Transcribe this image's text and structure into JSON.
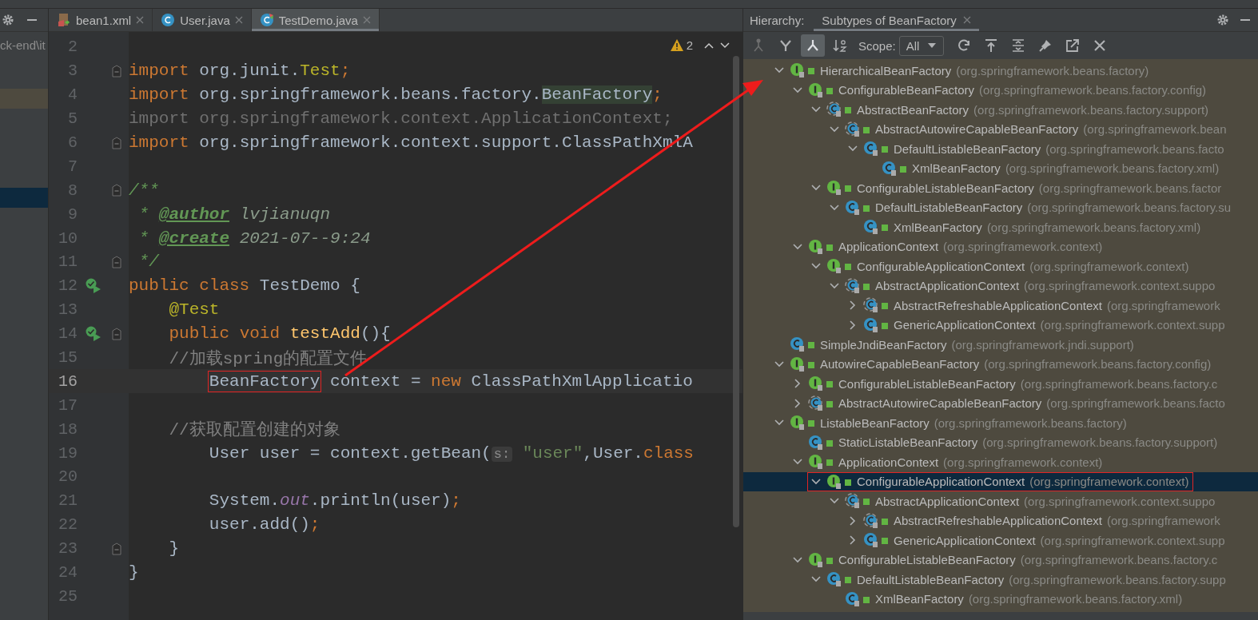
{
  "project_panel": {
    "path_fragment": "ck-end\\it"
  },
  "editor_tabs": [
    {
      "label": "bean1.xml",
      "kind": "xml",
      "selected": false
    },
    {
      "label": "User.java",
      "kind": "class",
      "selected": false
    },
    {
      "label": "TestDemo.java",
      "kind": "test",
      "selected": true
    }
  ],
  "inspection": {
    "warnings": "2"
  },
  "code_lines": [
    {
      "number": "2",
      "current": false
    },
    {
      "number": "3",
      "current": false,
      "fold": true,
      "tokens": [
        {
          "kind": "kw",
          "text": "import"
        },
        {
          "kind": "plain",
          "text": " org.junit."
        },
        {
          "kind": "ann",
          "text": "Test"
        },
        {
          "kind": "kw",
          "text": ";"
        }
      ]
    },
    {
      "number": "4",
      "current": false,
      "tokens": [
        {
          "kind": "kw",
          "text": "import"
        },
        {
          "kind": "plain",
          "text": " org.springframework.beans.factory."
        },
        {
          "kind": "usage",
          "text": "BeanFactory"
        },
        {
          "kind": "kw",
          "text": ";"
        }
      ]
    },
    {
      "number": "5",
      "current": false,
      "tokens": [
        {
          "kind": "unused",
          "text": "import org.springframework.context.ApplicationContext;"
        }
      ]
    },
    {
      "number": "6",
      "current": false,
      "fold": true,
      "tokens": [
        {
          "kind": "kw",
          "text": "import"
        },
        {
          "kind": "plain",
          "text": " org.springframework.context.support.ClassPathXmlA"
        }
      ]
    },
    {
      "number": "7",
      "current": false
    },
    {
      "number": "8",
      "current": false,
      "fold": true,
      "tokens": [
        {
          "kind": "doc",
          "text": "/**"
        }
      ]
    },
    {
      "number": "9",
      "current": false,
      "tokens": [
        {
          "kind": "doc",
          "text": " * "
        },
        {
          "kind": "doctag",
          "text": "@author"
        },
        {
          "kind": "docval",
          "text": " lvjianuqn"
        }
      ]
    },
    {
      "number": "10",
      "current": false,
      "tokens": [
        {
          "kind": "doc",
          "text": " * "
        },
        {
          "kind": "doctag",
          "text": "@create"
        },
        {
          "kind": "docval",
          "text": " 2021-07--9:24"
        }
      ]
    },
    {
      "number": "11",
      "current": false,
      "fold": true,
      "tokens": [
        {
          "kind": "doc",
          "text": " */"
        }
      ]
    },
    {
      "number": "12",
      "current": false,
      "run": true,
      "tokens": [
        {
          "kind": "kw",
          "text": "public class"
        },
        {
          "kind": "plain",
          "text": " TestDemo {"
        }
      ]
    },
    {
      "number": "13",
      "current": false,
      "tokens": [
        {
          "kind": "ann",
          "text": "    @Test"
        }
      ]
    },
    {
      "number": "14",
      "current": false,
      "run": true,
      "fold": true,
      "tokens": [
        {
          "kind": "kw",
          "text": "    public void"
        },
        {
          "kind": "method",
          "text": " testAdd"
        },
        {
          "kind": "plain",
          "text": "(){"
        }
      ]
    },
    {
      "number": "15",
      "current": false,
      "tokens": [
        {
          "kind": "comment",
          "text": "    //加载spring的配置文件"
        }
      ]
    },
    {
      "number": "16",
      "current": true,
      "tokens": [
        {
          "kind": "plain",
          "text": "        BeanFactory",
          "outlined": true
        },
        {
          "kind": "plain",
          "text": " context = "
        },
        {
          "kind": "kw",
          "text": "new"
        },
        {
          "kind": "plain",
          "text": " ClassPathXmlApplicatio"
        }
      ]
    },
    {
      "number": "17",
      "current": false
    },
    {
      "number": "18",
      "current": false,
      "tokens": [
        {
          "kind": "comment",
          "text": "    //获取配置创建的对象"
        }
      ]
    },
    {
      "number": "19",
      "current": false,
      "tokens": [
        {
          "kind": "plain",
          "text": "        User user = context.getBean("
        },
        {
          "kind": "hint",
          "text": "s:"
        },
        {
          "kind": "str",
          "text": " \"user\""
        },
        {
          "kind": "plain",
          "text": ",User."
        },
        {
          "kind": "kw",
          "text": "class"
        }
      ]
    },
    {
      "number": "20",
      "current": false
    },
    {
      "number": "21",
      "current": false,
      "tokens": [
        {
          "kind": "plain",
          "text": "        System."
        },
        {
          "kind": "static",
          "text": "out"
        },
        {
          "kind": "plain",
          "text": ".println(user)"
        },
        {
          "kind": "kw",
          "text": ";"
        }
      ]
    },
    {
      "number": "22",
      "current": false,
      "tokens": [
        {
          "kind": "plain",
          "text": "        user.add()"
        },
        {
          "kind": "kw",
          "text": ";"
        }
      ]
    },
    {
      "number": "23",
      "current": false,
      "fold": true,
      "tokens": [
        {
          "kind": "plain",
          "text": "    }"
        }
      ]
    },
    {
      "number": "24",
      "current": false,
      "tokens": [
        {
          "kind": "plain",
          "text": "}"
        }
      ]
    },
    {
      "number": "25",
      "current": false
    }
  ],
  "hierarchy": {
    "label": "Hierarchy:",
    "tab": "Subtypes of BeanFactory",
    "toolbar": [
      {
        "kind": "class-hierarchy",
        "selected": false
      },
      {
        "kind": "supertypes",
        "selected": false
      },
      {
        "kind": "subtypes",
        "selected": true
      },
      {
        "kind": "sort"
      }
    ],
    "scope_label": "Scope:",
    "scope_value": "All",
    "actions": [
      {
        "kind": "refresh"
      },
      {
        "kind": "export"
      },
      {
        "kind": "expand"
      },
      {
        "kind": "pin"
      },
      {
        "kind": "open"
      },
      {
        "kind": "close"
      }
    ],
    "tree": [
      {
        "name": "HierarchicalBeanFactory",
        "package": "(org.springframework.beans.factory)",
        "kind": "interface",
        "expanded": true,
        "selected": false,
        "children": [
          {
            "name": "ConfigurableBeanFactory",
            "package": "(org.springframework.beans.factory.config)",
            "kind": "interface",
            "expanded": true,
            "selected": false,
            "children": [
              {
                "name": "AbstractBeanFactory",
                "package": "(org.springframework.beans.factory.support)",
                "kind": "abstract",
                "expanded": true,
                "selected": false,
                "children": [
                  {
                    "name": "AbstractAutowireCapableBeanFactory",
                    "package": "(org.springframework.bean",
                    "kind": "abstract",
                    "expanded": true,
                    "selected": false,
                    "children": [
                      {
                        "name": "DefaultListableBeanFactory",
                        "package": "(org.springframework.beans.facto",
                        "kind": "class",
                        "expanded": true,
                        "selected": false,
                        "children": [
                          {
                            "name": "XmlBeanFactory",
                            "package": "(org.springframework.beans.factory.xml)",
                            "kind": "class",
                            "selected": false
                          }
                        ]
                      }
                    ]
                  }
                ]
              },
              {
                "name": "ConfigurableListableBeanFactory",
                "package": "(org.springframework.beans.factor",
                "kind": "interface",
                "expanded": true,
                "selected": false,
                "children": [
                  {
                    "name": "DefaultListableBeanFactory",
                    "package": "(org.springframework.beans.factory.su",
                    "kind": "class",
                    "expanded": true,
                    "selected": false,
                    "children": [
                      {
                        "name": "XmlBeanFactory",
                        "package": "(org.springframework.beans.factory.xml)",
                        "kind": "class",
                        "selected": false
                      }
                    ]
                  }
                ]
              }
            ]
          },
          {
            "name": "ApplicationContext",
            "package": "(org.springframework.context)",
            "kind": "interface",
            "expanded": true,
            "selected": false,
            "children": [
              {
                "name": "ConfigurableApplicationContext",
                "package": "(org.springframework.context)",
                "kind": "interface",
                "expanded": true,
                "selected": false,
                "children": [
                  {
                    "name": "AbstractApplicationContext",
                    "package": "(org.springframework.context.suppo",
                    "kind": "abstract",
                    "expanded": true,
                    "selected": false,
                    "children": [
                      {
                        "name": "AbstractRefreshableApplicationContext",
                        "package": "(org.springframework",
                        "kind": "abstract",
                        "expanded": false,
                        "selected": false
                      },
                      {
                        "name": "GenericApplicationContext",
                        "package": "(org.springframework.context.supp",
                        "kind": "class",
                        "expanded": false,
                        "selected": false
                      }
                    ]
                  }
                ]
              }
            ]
          }
        ]
      },
      {
        "name": "SimpleJndiBeanFactory",
        "package": "(org.springframework.jndi.support)",
        "kind": "class",
        "selected": false
      },
      {
        "name": "AutowireCapableBeanFactory",
        "package": "(org.springframework.beans.factory.config)",
        "kind": "interface",
        "expanded": true,
        "selected": false,
        "children": [
          {
            "name": "ConfigurableListableBeanFactory",
            "package": "(org.springframework.beans.factory.c",
            "kind": "interface",
            "expanded": false,
            "selected": false
          },
          {
            "name": "AbstractAutowireCapableBeanFactory",
            "package": "(org.springframework.beans.facto",
            "kind": "abstract",
            "expanded": false,
            "selected": false
          }
        ]
      },
      {
        "name": "ListableBeanFactory",
        "package": "(org.springframework.beans.factory)",
        "kind": "interface",
        "expanded": true,
        "selected": false,
        "children": [
          {
            "name": "StaticListableBeanFactory",
            "package": "(org.springframework.beans.factory.support)",
            "kind": "class",
            "selected": false
          },
          {
            "name": "ApplicationContext",
            "package": "(org.springframework.context)",
            "kind": "interface",
            "expanded": true,
            "selected": false,
            "children": [
              {
                "name": "ConfigurableApplicationContext",
                "package": "(org.springframework.context)",
                "kind": "interface",
                "expanded": true,
                "selected": true,
                "outlined": true,
                "children": [
                  {
                    "name": "AbstractApplicationContext",
                    "package": "(org.springframework.context.suppo",
                    "kind": "abstract",
                    "expanded": true,
                    "selected": false,
                    "children": [
                      {
                        "name": "AbstractRefreshableApplicationContext",
                        "package": "(org.springframework",
                        "kind": "abstract",
                        "expanded": false,
                        "selected": false
                      },
                      {
                        "name": "GenericApplicationContext",
                        "package": "(org.springframework.context.supp",
                        "kind": "class",
                        "expanded": false,
                        "selected": false
                      }
                    ]
                  }
                ]
              }
            ]
          },
          {
            "name": "ConfigurableListableBeanFactory",
            "package": "(org.springframework.beans.factory.c",
            "kind": "interface",
            "expanded": true,
            "selected": false,
            "children": [
              {
                "name": "DefaultListableBeanFactory",
                "package": "(org.springframework.beans.factory.supp",
                "kind": "class",
                "expanded": true,
                "selected": false,
                "children": [
                  {
                    "name": "XmlBeanFactory",
                    "package": "(org.springframework.beans.factory.xml)",
                    "kind": "class",
                    "selected": false
                  }
                ]
              }
            ]
          }
        ]
      }
    ]
  }
}
